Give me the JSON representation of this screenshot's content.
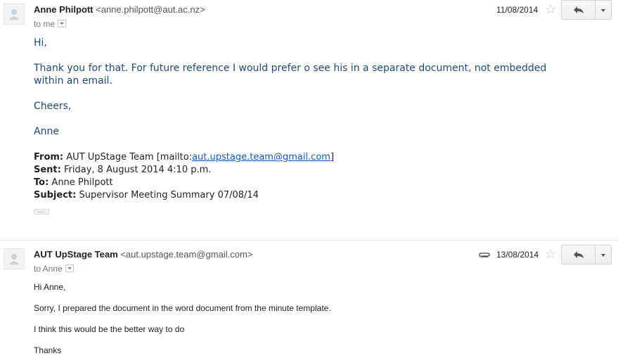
{
  "messages": [
    {
      "sender_name": "Anne Philpott",
      "sender_email": "<anne.philpott@aut.ac.nz>",
      "recipient": "to me",
      "date": "11/08/2014",
      "body": [
        "Hi,",
        "Thank you for that. For future reference I would prefer o see his in a separate document, not embedded",
        "within an email.",
        "Cheers,",
        "Anne"
      ],
      "quoted_header": {
        "from_label": "From:",
        "from_value": "AUT UpStage Team [mailto:",
        "from_link": "aut.upstage.team@gmail.com",
        "from_close": "]",
        "sent_label": "Sent:",
        "sent_value": "Friday, 8 August 2014 4:10 p.m.",
        "to_label": "To:",
        "to_value": "Anne Philpott",
        "subject_label": "Subject:",
        "subject_value": "Supervisor Meeting Summary 07/08/14"
      },
      "ellipsis": "..."
    },
    {
      "sender_name": "AUT UpStage Team",
      "sender_email": "<aut.upstage.team@gmail.com>",
      "recipient": "to Anne",
      "date": "13/08/2014",
      "has_attachment": true,
      "body": [
        "Hi Anne,",
        "Sorry, I prepared the document in the word document from the minute template.",
        "I think this would be the better way to do",
        "Thanks"
      ]
    }
  ],
  "icons": {
    "star": "☆",
    "reply": "reply-icon",
    "more": "chevron-down-icon",
    "attachment": "paperclip-icon",
    "avatar": "person-icon"
  },
  "colors": {
    "quote_text": "#1f497d",
    "link": "#1155cc"
  }
}
